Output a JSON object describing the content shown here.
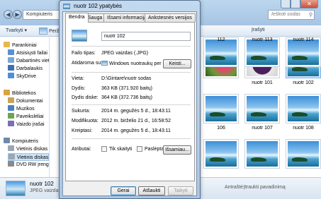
{
  "explorer": {
    "address": "Kompiuteris",
    "search_placeholder": "Ieškoti sodas",
    "toolbar": {
      "organize": "Tvarkyti",
      "share": "Perži",
      "burn": "Įrašyti"
    },
    "nav": [
      {
        "label": "Parankiniai",
        "color": "#e8b84a"
      },
      {
        "label": "Atsisiųsti failai",
        "color": "#5a8fd0"
      },
      {
        "label": "Dabartinės vietos",
        "color": "#7aa6d6"
      },
      {
        "label": "Darbalaukis",
        "color": "#3d6fb3"
      },
      {
        "label": "SkyDrive",
        "color": "#4c8fd6"
      },
      {
        "label": "Bibliotekos",
        "color": "#d9a441"
      },
      {
        "label": "Dokumentai",
        "color": "#c9a35a"
      },
      {
        "label": "Muzikos",
        "color": "#4a7fc2"
      },
      {
        "label": "Paveikslėliai",
        "color": "#6aa552"
      },
      {
        "label": "Vaizdo įrašai",
        "color": "#7a6fb8"
      },
      {
        "label": "Kompiuteris",
        "color": "#6f8aa8"
      },
      {
        "label": "Vietinis diskas",
        "color": "#9aa7b5"
      },
      {
        "label": "Vietinis diskas",
        "color": "#9aa7b5"
      },
      {
        "label": "DVD RW įrenginys",
        "color": "#8a8a8a"
      }
    ],
    "thumbs": [
      {
        "label": "",
        "kind": "flower-red"
      },
      {
        "label": "nuotr 101",
        "kind": "flower-purple"
      },
      {
        "label": "nuotr 102",
        "kind": "sea",
        "selected": true
      },
      {
        "label": "106",
        "kind": "sea"
      },
      {
        "label": "nuotr 107",
        "kind": "sea"
      },
      {
        "label": "nuotr 108",
        "kind": "sea"
      },
      {
        "label": "",
        "kind": "sea"
      },
      {
        "label": "",
        "kind": "sea"
      },
      {
        "label": "",
        "kind": "sea"
      },
      {
        "label": "112",
        "kind": "sea"
      },
      {
        "label": "nuotr 113",
        "kind": "sea"
      },
      {
        "label": "nuotr 114",
        "kind": "sea"
      }
    ],
    "status": {
      "name": "nuotr 102",
      "type": "JPEG vaizdas",
      "tag_label": "Antraštė:",
      "tag_value": "Įtraukti pavadinimą"
    }
  },
  "dialog": {
    "title": "nuotr 102 ypatybės",
    "tabs": [
      "Bendra",
      "Sauga",
      "Išsami informacija",
      "Ankstesnės versijos"
    ],
    "file_name": "nuotr 102",
    "rows": {
      "type_label": "Failo tipas:",
      "type_value": "JPEG vaizdas (.JPG)",
      "opens_label": "Atidaroma su:",
      "opens_value": "Windows nuotraukų per",
      "change_button": "Keisti...",
      "location_label": "Vieta:",
      "location_value": "D:\\Gintare\\nuotr sodas",
      "size_label": "Dydis:",
      "size_value": "363 KB (371.920 baitų)",
      "disk_label": "Dydis diske:",
      "disk_value": "364 KB (372.736 baitų)",
      "created_label": "Sukurta:",
      "created_value": "2014 m. gegužės 5 d., 18:43:11",
      "modified_label": "Modifikuota:",
      "modified_value": "2012 m. birželio 21 d., 16:58:52",
      "accessed_label": "Kreiptasi:",
      "accessed_value": "2014 m. gegužės 5 d., 18:43:11",
      "attrs_label": "Atributai:",
      "readonly_label": "Tik skaityti",
      "hidden_label": "Paslėptas",
      "advanced_button": "Išsamiau..."
    },
    "buttons": {
      "ok": "Gerai",
      "cancel": "Atšaukti",
      "apply": "Taikyti"
    }
  }
}
